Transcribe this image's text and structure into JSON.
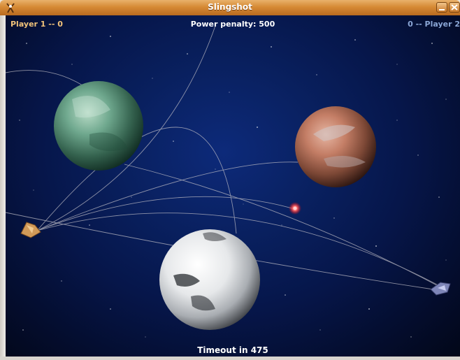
{
  "window": {
    "title": "Slingshot"
  },
  "hud": {
    "player1": "Player 1  --  0",
    "power_penalty": "Power penalty: 500",
    "player2": "0  --  Player 2",
    "timeout": "Timeout in 475"
  },
  "colors": {
    "player1": "#f0c27a",
    "player2": "#8aa6d6",
    "titlebar": "#d68a35",
    "space": "#09205f",
    "trail": "#b9b8c2",
    "shot": "#ff3b3b"
  },
  "icons": {
    "app": "slingshot-icon",
    "minimize": "minimize-icon",
    "close": "close-icon"
  }
}
